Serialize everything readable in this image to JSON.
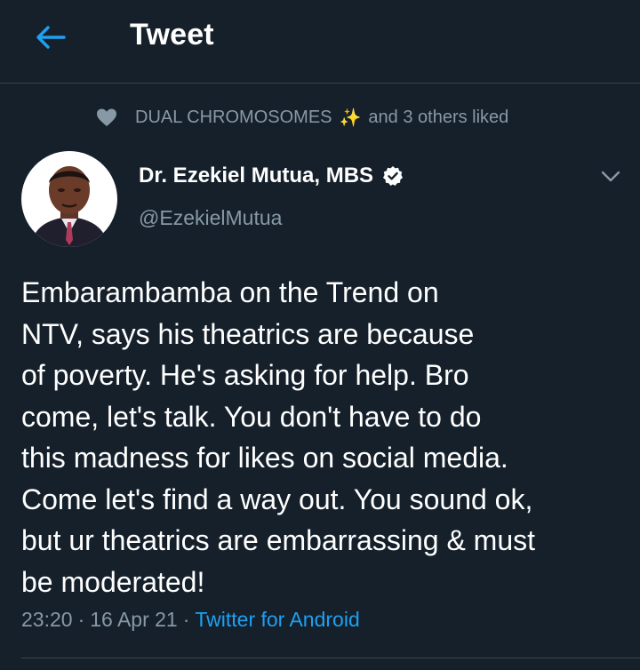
{
  "header": {
    "title": "Tweet",
    "back_icon": "back-arrow-icon"
  },
  "social_context": {
    "icon": "heart-icon",
    "liker": "DUAL CHROMOSOMES",
    "emoji": "✨",
    "suffix": "and 3 others liked"
  },
  "author": {
    "name": "Dr. Ezekiel Mutua, MBS",
    "handle": "@EzekielMutua",
    "verified": true
  },
  "tweet": {
    "text": "Embarambamba on the Trend on\nNTV, says his theatrics are because\nof poverty. He's asking for help. Bro\ncome, let's talk. You don't have to do\nthis madness for likes on social media.\nCome let's find a way out. You sound ok,\nbut ur theatrics are embarrassing & must\nbe moderated!",
    "time": "23:20",
    "date": "16 Apr 21",
    "separator": "·",
    "source": "Twitter for Android"
  },
  "colors": {
    "background": "#15202b",
    "accent": "#1da1f2",
    "muted": "#8899a6",
    "divider": "#38444d"
  }
}
